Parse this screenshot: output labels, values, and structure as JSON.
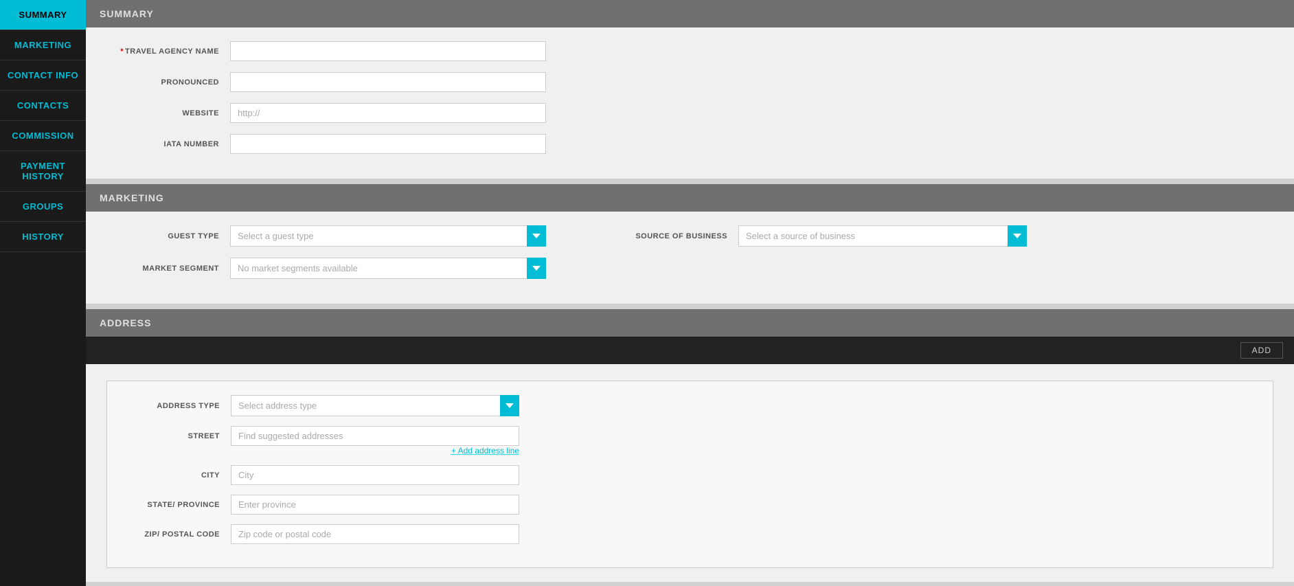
{
  "sidebar": {
    "items": [
      {
        "label": "SUMMARY",
        "active": true
      },
      {
        "label": "MARKETING",
        "active": false
      },
      {
        "label": "CONTACT INFO",
        "active": false
      },
      {
        "label": "CONTACTS",
        "active": false
      },
      {
        "label": "COMMISSION",
        "active": false
      },
      {
        "label": "PAYMENT HISTORY",
        "active": false
      },
      {
        "label": "GROUPS",
        "active": false
      },
      {
        "label": "HISTORY",
        "active": false
      }
    ]
  },
  "summary": {
    "header": "SUMMARY",
    "fields": {
      "travel_agency_name_label": "TRAVEL AGENCY NAME",
      "pronounced_label": "PRONOUNCED",
      "website_label": "WEBSITE",
      "website_placeholder": "http://",
      "iata_number_label": "IATA NUMBER"
    }
  },
  "marketing": {
    "header": "MARKETING",
    "guest_type_label": "GUEST TYPE",
    "guest_type_placeholder": "Select a guest type",
    "source_of_business_label": "SOURCE OF BUSINESS",
    "source_of_business_placeholder": "Select a source of business",
    "market_segment_label": "MARKET SEGMENT",
    "market_segment_placeholder": "No market segments available"
  },
  "address": {
    "header": "ADDRESS",
    "add_button": "ADD",
    "address_type_label": "ADDRESS TYPE",
    "address_type_placeholder": "Select address type",
    "street_label": "STREET",
    "street_placeholder": "Find suggested addresses",
    "add_address_line": "+ Add address line",
    "city_label": "CITY",
    "city_placeholder": "City",
    "state_province_label": "STATE/ PROVINCE",
    "state_province_placeholder": "Enter province",
    "zip_postal_code_label": "ZIP/ POSTAL CODE",
    "zip_postal_code_placeholder": "Zip code or postal code"
  }
}
